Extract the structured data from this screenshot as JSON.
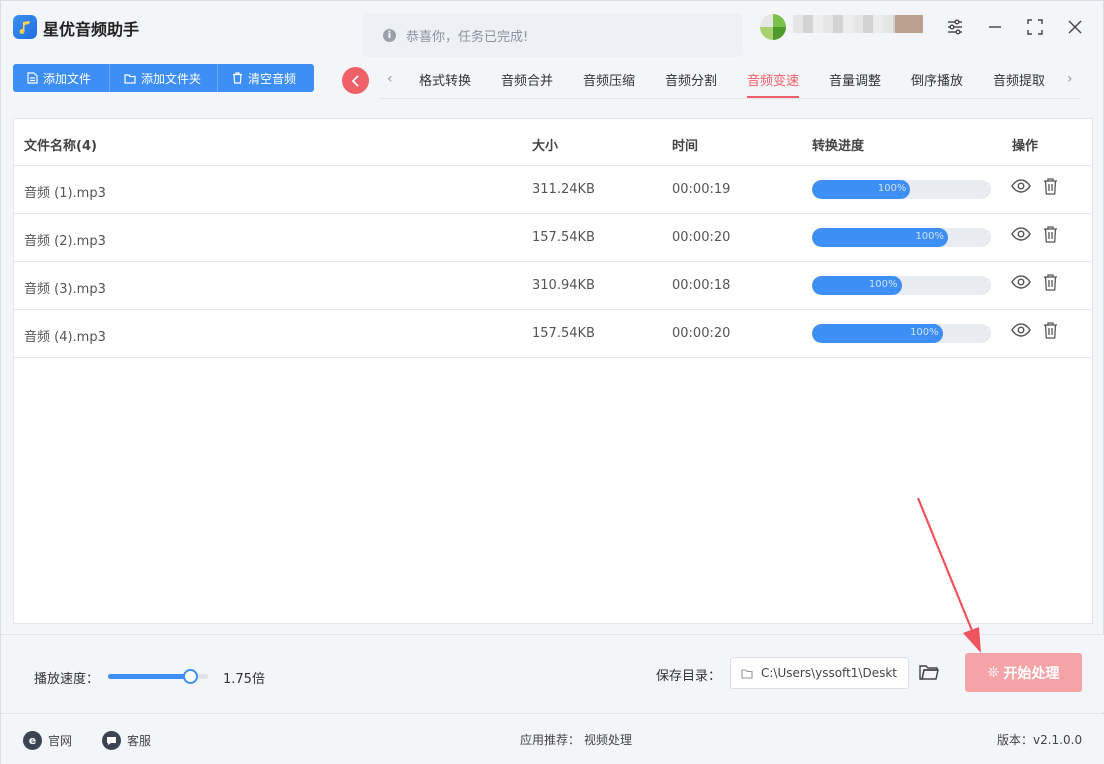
{
  "app": {
    "title": "星优音频助手"
  },
  "notice": {
    "text": "恭喜你，任务已完成!"
  },
  "toolbar": {
    "add_file": "添加文件",
    "add_folder": "添加文件夹",
    "clear": "清空音频"
  },
  "tabs": [
    "格式转换",
    "音频合并",
    "音频压缩",
    "音频分割",
    "音频变速",
    "音量调整",
    "倒序播放",
    "音频提取"
  ],
  "active_tab": "音频变速",
  "table": {
    "headers": {
      "name": "文件名称(4)",
      "size": "大小",
      "time": "时间",
      "progress": "转换进度",
      "ops": "操作"
    },
    "rows": [
      {
        "name": "音频 (1).mp3",
        "size": "311.24KB",
        "time": "00:00:19",
        "progress_label": "100%",
        "progress_fill": 0.55
      },
      {
        "name": "音频 (2).mp3",
        "size": "157.54KB",
        "time": "00:00:20",
        "progress_label": "100%",
        "progress_fill": 0.76
      },
      {
        "name": "音频 (3).mp3",
        "size": "310.94KB",
        "time": "00:00:18",
        "progress_label": "100%",
        "progress_fill": 0.5
      },
      {
        "name": "音频 (4).mp3",
        "size": "157.54KB",
        "time": "00:00:20",
        "progress_label": "100%",
        "progress_fill": 0.73
      }
    ]
  },
  "settings": {
    "speed_label": "播放速度：",
    "speed_value": "1.75倍",
    "speed_fraction": 0.82,
    "save_label": "保存目录：",
    "save_path": "C:\\Users\\yssoft1\\Deskt",
    "start_button": "开始处理"
  },
  "statusbar": {
    "website": "官网",
    "support": "客服",
    "recommend_label": "应用推荐：",
    "recommend_app": "视频处理",
    "version": "版本：v2.1.0.0"
  },
  "colors": {
    "accent": "#3d8ef5",
    "active_tab": "#f06068",
    "start_button": "#f6a3a8",
    "annotation_arrow": "#f0545c"
  }
}
